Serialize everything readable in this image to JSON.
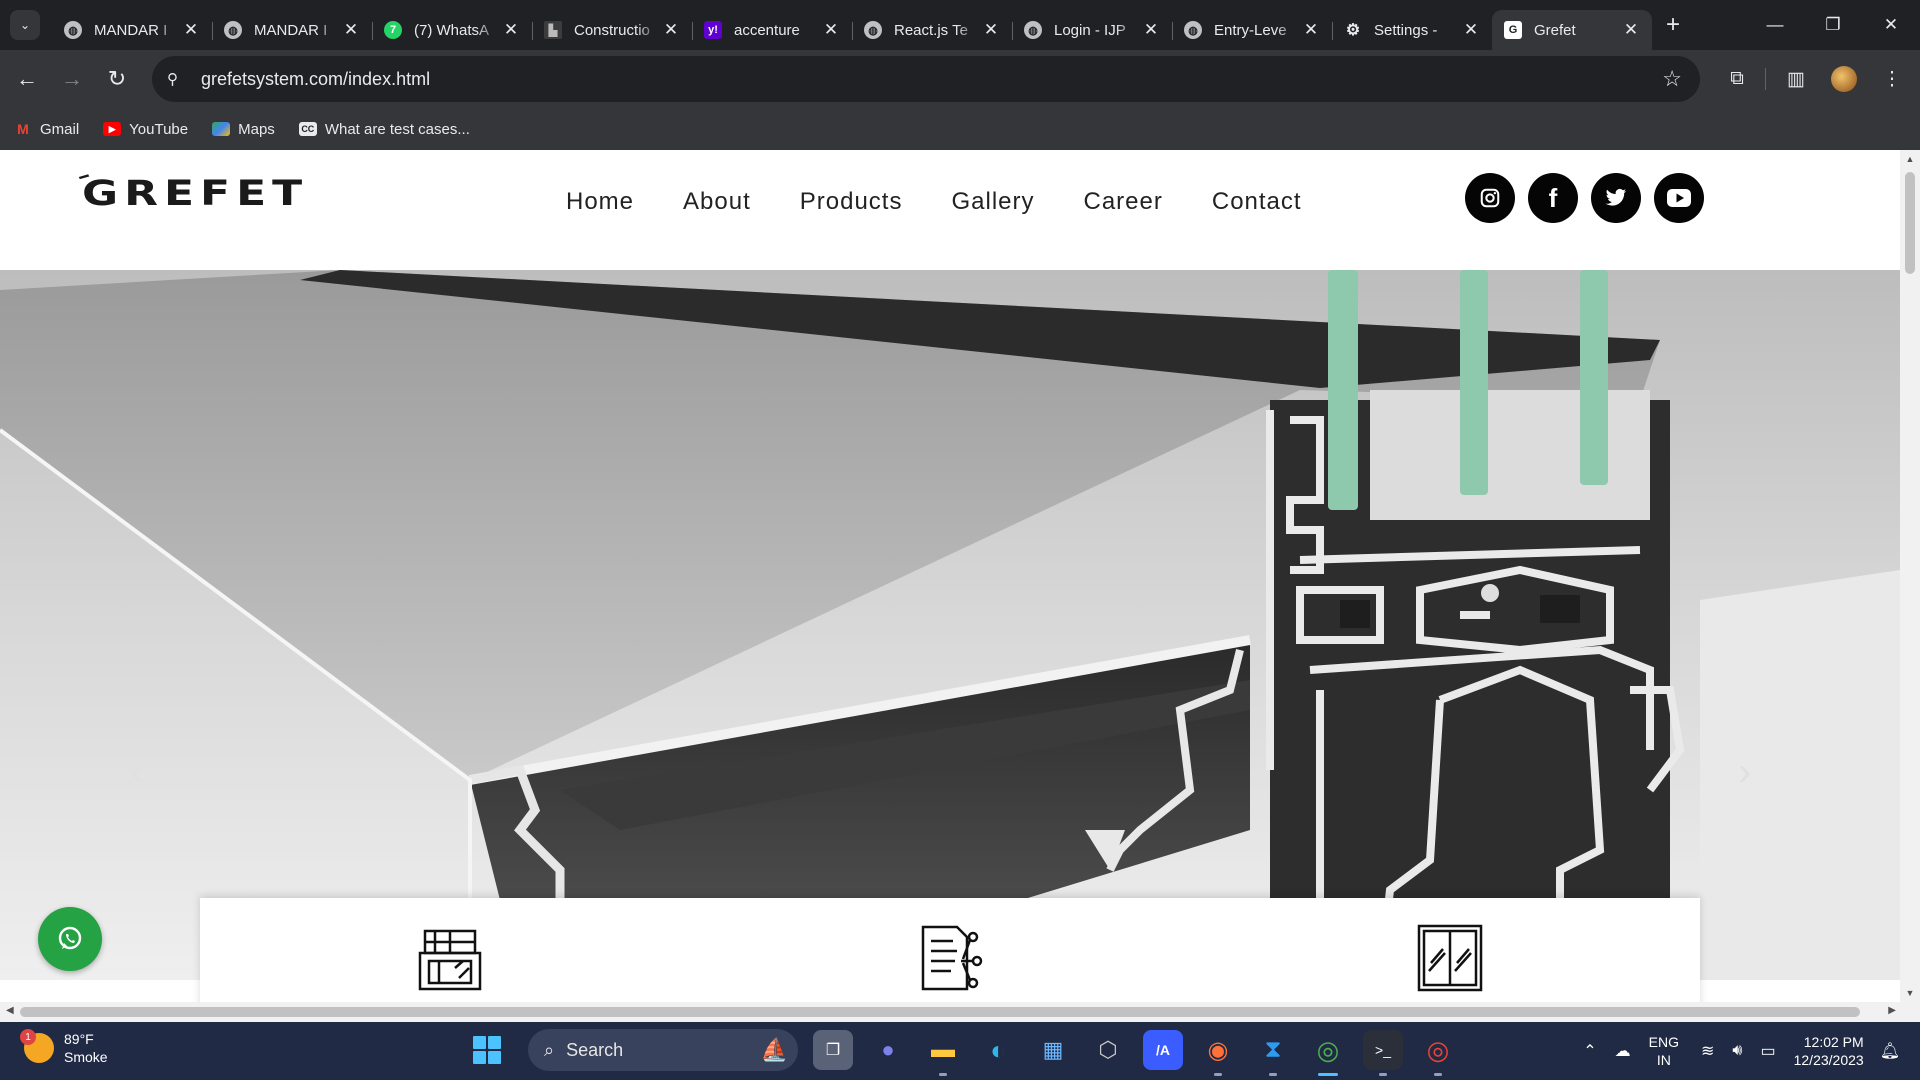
{
  "browser": {
    "tabs": [
      {
        "title": "MANDAR I",
        "favicon": "globe-icon"
      },
      {
        "title": "MANDAR I",
        "favicon": "globe-icon"
      },
      {
        "title": "(7) WhatsA",
        "favicon": "whatsapp-icon"
      },
      {
        "title": "Constructio",
        "favicon": "construction-icon"
      },
      {
        "title": "accenture",
        "favicon": "yahoo-icon"
      },
      {
        "title": "React.js Te",
        "favicon": "globe-icon"
      },
      {
        "title": "Login - IJP",
        "favicon": "globe-icon"
      },
      {
        "title": "Entry-Leve",
        "favicon": "globe-icon"
      },
      {
        "title": "Settings -",
        "favicon": "gear-icon"
      },
      {
        "title": "Grefet",
        "favicon": "grefet-icon",
        "active": true
      }
    ],
    "url": "grefetsystem.com/index.html",
    "bookmarks": [
      {
        "label": "Gmail",
        "icon": "gmail-icon"
      },
      {
        "label": "YouTube",
        "icon": "youtube-icon"
      },
      {
        "label": "Maps",
        "icon": "maps-icon"
      },
      {
        "label": "What are test cases...",
        "icon": "cc-icon"
      }
    ]
  },
  "site": {
    "logo": "GREFET",
    "nav": [
      "Home",
      "About",
      "Products",
      "Gallery",
      "Career",
      "Contact"
    ],
    "social": [
      "instagram-icon",
      "facebook-icon",
      "twitter-icon",
      "youtube-icon"
    ],
    "feature_icons": [
      "building-facade-icon",
      "document-network-icon",
      "sliding-window-icon"
    ]
  },
  "taskbar": {
    "weather": {
      "temp": "89°F",
      "condition": "Smoke",
      "badge": "1"
    },
    "search_placeholder": "Search",
    "language": {
      "line1": "ENG",
      "line2": "IN"
    },
    "clock": {
      "time": "12:02 PM",
      "date": "12/23/2023"
    }
  },
  "colors": {
    "accent_whatsapp": "#25a244",
    "chrome_dark": "#202124",
    "chrome_toolbar": "#35363a",
    "taskbar": "#202a44"
  }
}
